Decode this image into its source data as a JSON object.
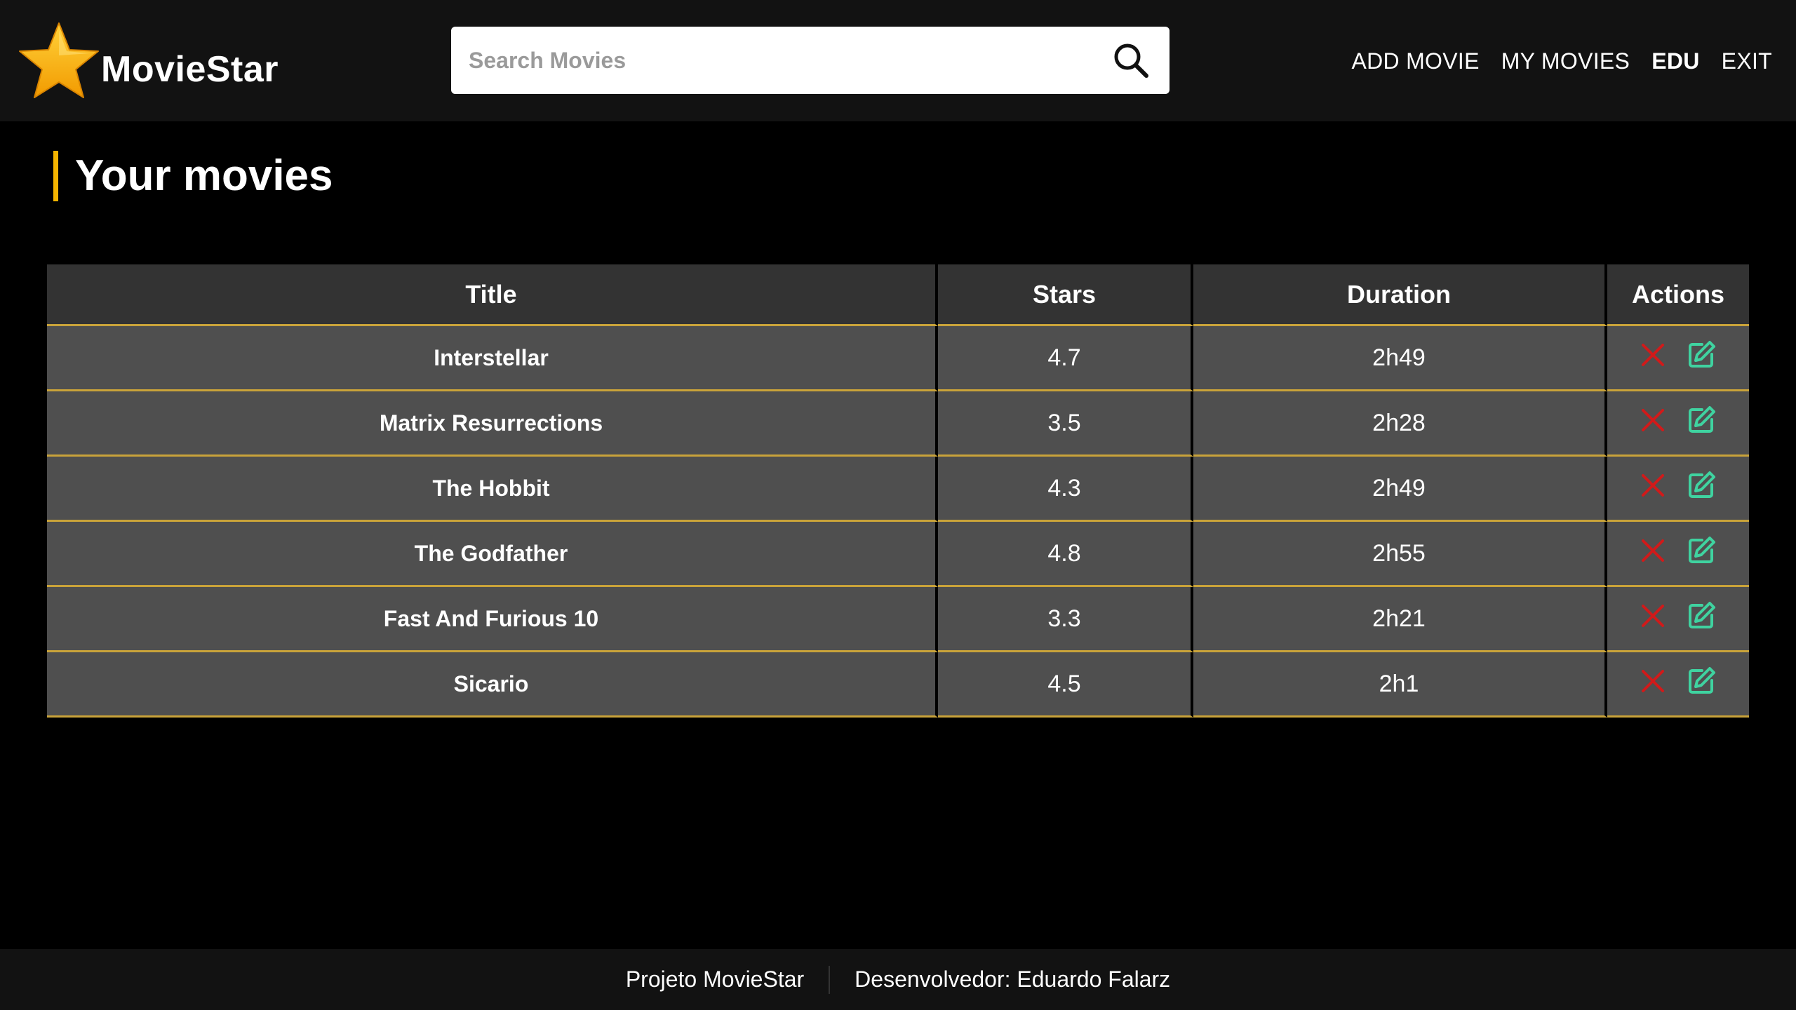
{
  "header": {
    "brand": "MovieStar",
    "search_placeholder": "Search Movies",
    "nav": [
      {
        "label": "ADD MOVIE",
        "active": false
      },
      {
        "label": "MY MOVIES",
        "active": false
      },
      {
        "label": "EDU",
        "active": true
      },
      {
        "label": "EXIT",
        "active": false
      }
    ]
  },
  "main": {
    "title": "Your movies",
    "table": {
      "columns": [
        "Title",
        "Stars",
        "Duration",
        "Actions"
      ],
      "rows": [
        {
          "title": "Interstellar",
          "stars": "4.7",
          "duration": "2h49"
        },
        {
          "title": "Matrix Resurrections",
          "stars": "3.5",
          "duration": "2h28"
        },
        {
          "title": "The Hobbit",
          "stars": "4.3",
          "duration": "2h49"
        },
        {
          "title": "The Godfather",
          "stars": "4.8",
          "duration": "2h55"
        },
        {
          "title": "Fast And Furious 10",
          "stars": "3.3",
          "duration": "2h21"
        },
        {
          "title": "Sicario",
          "stars": "4.5",
          "duration": "2h1"
        }
      ],
      "action_icons": [
        "delete-icon",
        "edit-icon"
      ]
    }
  },
  "footer": {
    "project": "Projeto MovieStar",
    "developer": "Desenvolvedor: Eduardo Falarz"
  },
  "colors": {
    "accent": "#f4b400",
    "row_border": "#c9a33a",
    "delete": "#d11a1a",
    "edit": "#3fd3a0",
    "header_bg": "#121212",
    "row_bg": "#4f4f4f",
    "head_bg": "#333333"
  }
}
